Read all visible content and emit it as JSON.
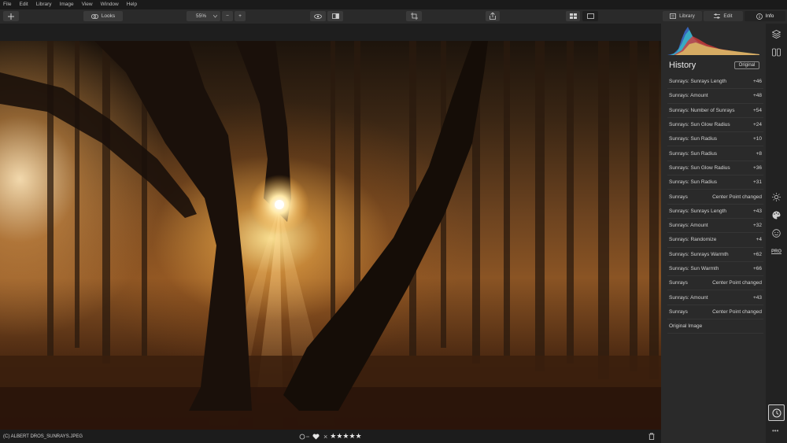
{
  "menu": [
    "File",
    "Edit",
    "Library",
    "Image",
    "View",
    "Window",
    "Help"
  ],
  "toolbar": {
    "looks_label": "Looks",
    "zoom_value": "55%",
    "zoom_minus": "−",
    "zoom_plus": "+"
  },
  "tabs": [
    {
      "label": "Library",
      "icon": "library-icon"
    },
    {
      "label": "Edit",
      "icon": "sliders-icon"
    },
    {
      "label": "Info",
      "icon": "info-icon"
    }
  ],
  "panel": {
    "title": "History",
    "original_button": "Original",
    "history": [
      {
        "name": "Sunrays: Sunrays Length",
        "detail": "",
        "value": "+46"
      },
      {
        "name": "Sunrays: Amount",
        "detail": "",
        "value": "+48"
      },
      {
        "name": "Sunrays: Number of Sunrays",
        "detail": "",
        "value": "+54"
      },
      {
        "name": "Sunrays: Sun Glow Radius",
        "detail": "",
        "value": "+24"
      },
      {
        "name": "Sunrays: Sun Radius",
        "detail": "",
        "value": "+10"
      },
      {
        "name": "Sunrays: Sun Radius",
        "detail": "",
        "value": "+8"
      },
      {
        "name": "Sunrays: Sun Glow Radius",
        "detail": "",
        "value": "+36"
      },
      {
        "name": "Sunrays: Sun Radius",
        "detail": "",
        "value": "+31"
      },
      {
        "name": "Sunrays",
        "detail": "Center Point changed",
        "value": ""
      },
      {
        "name": "Sunrays: Sunrays Length",
        "detail": "",
        "value": "+43"
      },
      {
        "name": "Sunrays: Amount",
        "detail": "",
        "value": "+32"
      },
      {
        "name": "Sunrays: Randomize",
        "detail": "",
        "value": "+4"
      },
      {
        "name": "Sunrays: Sunrays Warmth",
        "detail": "",
        "value": "+62"
      },
      {
        "name": "Sunrays: Sun Warmth",
        "detail": "",
        "value": "+66"
      },
      {
        "name": "Sunrays",
        "detail": "Center Point changed",
        "value": ""
      },
      {
        "name": "Sunrays: Amount",
        "detail": "",
        "value": "+43"
      },
      {
        "name": "Sunrays",
        "detail": "Center Point changed",
        "value": ""
      },
      {
        "name": "Original Image",
        "detail": "",
        "value": ""
      }
    ]
  },
  "status": {
    "filename": "(C) ALBERT DROS_SUNRAYS.JPEG",
    "reject": "×",
    "stars": "★★★★★",
    "pro_label": "PRO",
    "more": "•••"
  },
  "colors": {
    "panel_bg": "#2a2a2a",
    "toolbar_bg": "#2a2a2a",
    "accent_highlight": "#cfcfcf"
  }
}
